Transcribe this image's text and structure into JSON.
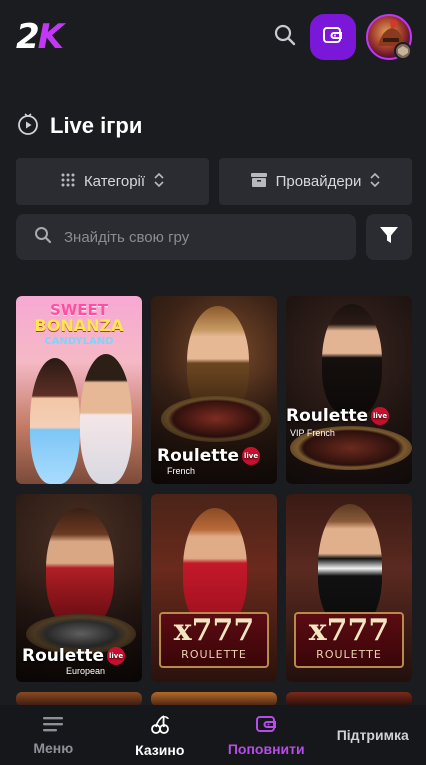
{
  "header": {
    "logo_main": "2",
    "logo_accent": "K"
  },
  "section": {
    "title": "Live ігри"
  },
  "filters": {
    "categories": "Категорії",
    "providers": "Провайдери"
  },
  "search": {
    "placeholder": "Знайдіть свою гру"
  },
  "games": [
    {
      "name": "Sweet Bonanza CandyLand",
      "line1": "SWEET",
      "line2": "BONANZA",
      "line3": "CANDYLAND"
    },
    {
      "name": "Roulette",
      "subtitle": "French",
      "badge": "live"
    },
    {
      "name": "Roulette",
      "subtitle": "VIP French",
      "badge": "live"
    },
    {
      "name": "Roulette",
      "subtitle": "European",
      "badge": "live"
    },
    {
      "name": "x777",
      "subtitle": "ROULETTE"
    },
    {
      "name": "x777",
      "subtitle": "ROULETTE"
    }
  ],
  "nav": {
    "menu": "Меню",
    "casino": "Казино",
    "deposit": "Поповнити",
    "support": "Підтримка"
  },
  "colors": {
    "accent": "#7b17d8",
    "brand_purple": "#c137f5",
    "background": "#1b1c20",
    "panel": "#2a2c31"
  }
}
